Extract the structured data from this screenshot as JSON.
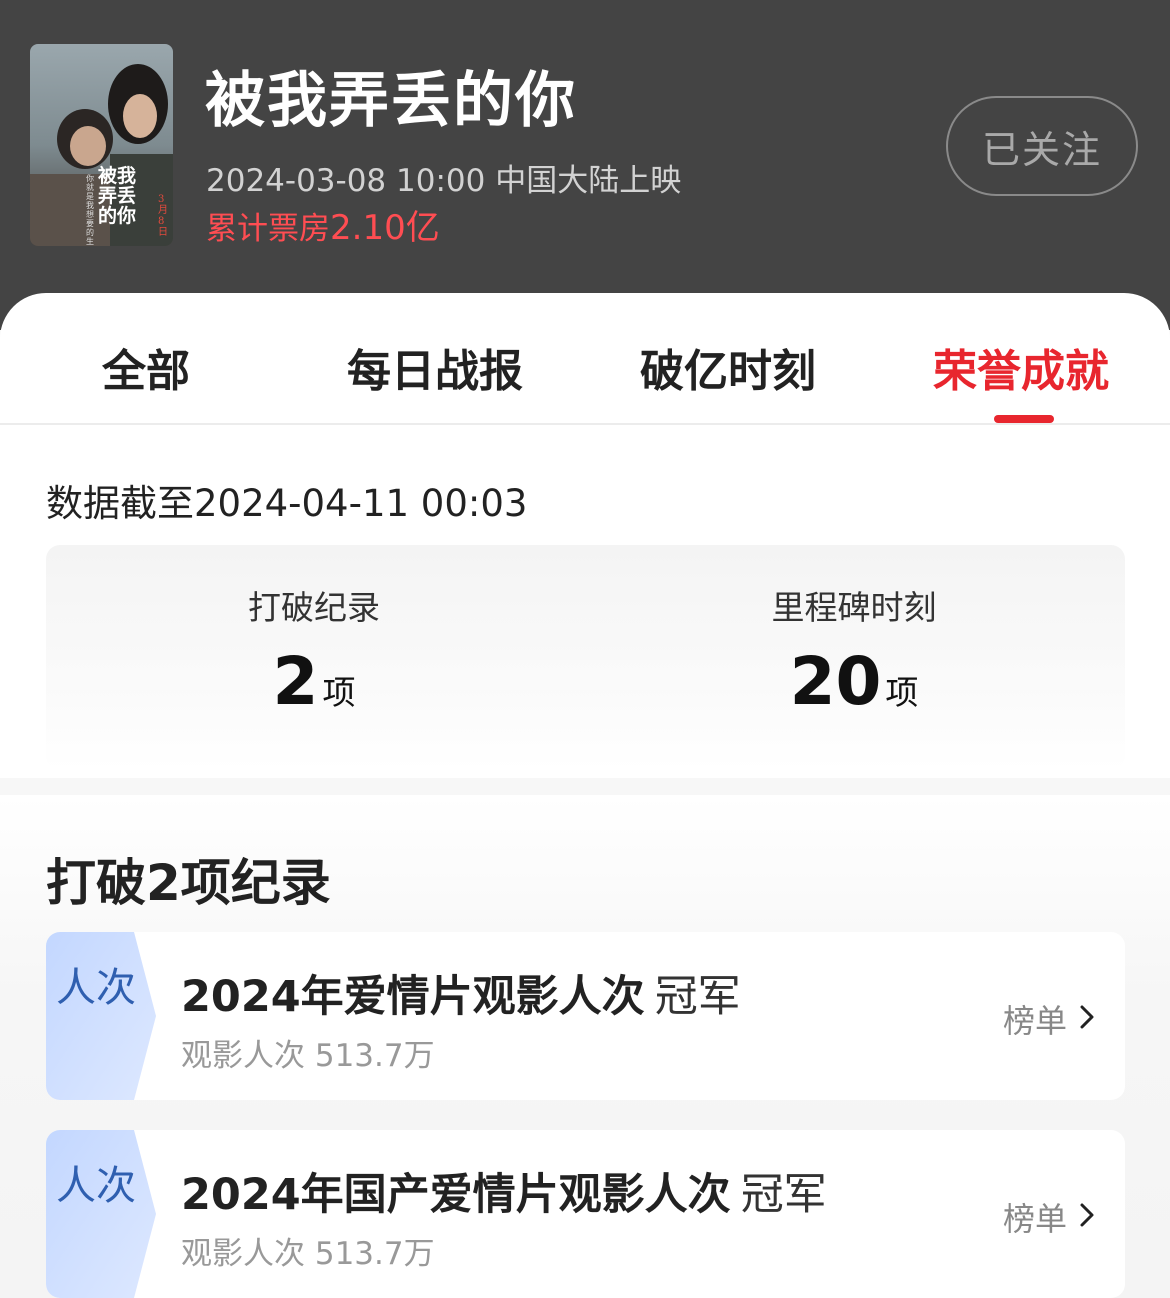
{
  "header": {
    "movie_title": "被我弄丢的你",
    "release_info": "2024-03-08 10:00 中国大陆上映",
    "box_office_label": "累计票房",
    "box_office_value": "2.10亿",
    "follow_label": "已关注",
    "poster": {
      "title_text": "被我弄丢的你",
      "date_text": "3月8日",
      "tagline": "你就是我想要的生活"
    }
  },
  "tabs": [
    {
      "label": "全部",
      "active": false
    },
    {
      "label": "每日战报",
      "active": false
    },
    {
      "label": "破亿时刻",
      "active": false
    },
    {
      "label": "荣誉成就",
      "active": true
    }
  ],
  "summary": {
    "data_as_of": "数据截至2024-04-11  00:03",
    "stats": [
      {
        "label": "打破纪录",
        "value": "2",
        "unit": "项"
      },
      {
        "label": "里程碑时刻",
        "value": "20",
        "unit": "项"
      }
    ]
  },
  "records": {
    "title": "打破2项纪录",
    "items": [
      {
        "badge": "人次",
        "name": "2024年爱情片观影人次",
        "rank": "冠军",
        "sub": "观影人次 513.7万",
        "link": "榜单"
      },
      {
        "badge": "人次",
        "name": "2024年国产爱情片观影人次",
        "rank": "冠军",
        "sub": "观影人次 513.7万",
        "link": "榜单"
      }
    ]
  },
  "colors": {
    "accent_red": "#e8262e",
    "header_bg": "#444444",
    "badge_blue": "#cfe0ff"
  }
}
